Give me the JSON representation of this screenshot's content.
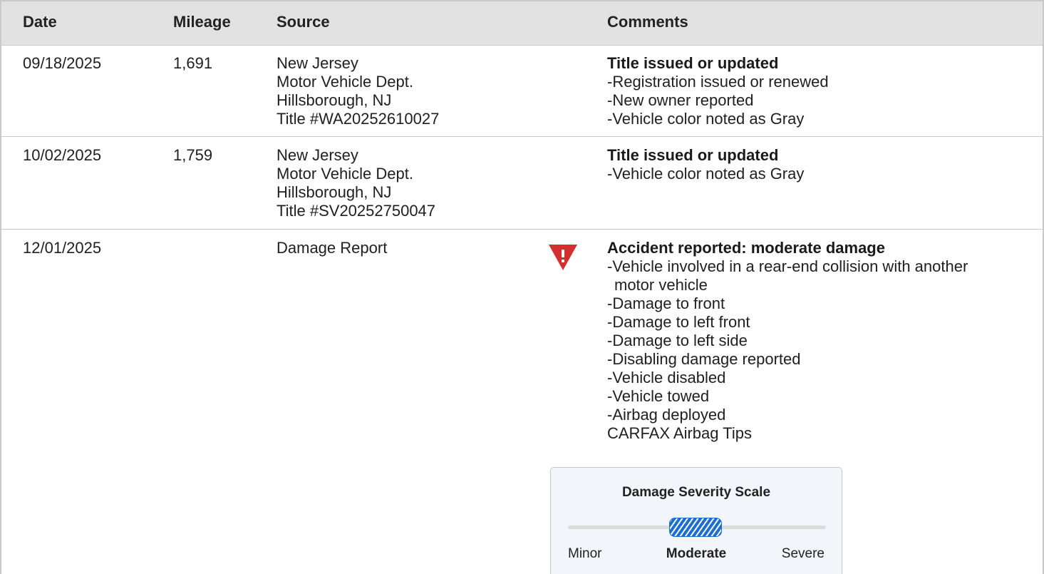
{
  "table": {
    "headers": {
      "date": "Date",
      "mileage": "Mileage",
      "source": "Source",
      "comments": "Comments"
    },
    "rows": [
      {
        "date": "09/18/2025",
        "mileage": "1,691",
        "source": [
          "New Jersey",
          "Motor Vehicle Dept.",
          "Hillsborough, NJ",
          "Title #WA20252610027"
        ],
        "event_title": "Title issued or updated",
        "details": [
          "Registration issued or renewed",
          "New owner reported",
          "Vehicle color noted as Gray"
        ]
      },
      {
        "date": "10/02/2025",
        "mileage": "1,759",
        "source": [
          "New Jersey",
          "Motor Vehicle Dept.",
          "Hillsborough, NJ",
          "Title #SV20252750047"
        ],
        "event_title": "Title issued or updated",
        "details": [
          "Vehicle color noted as Gray"
        ]
      },
      {
        "date": "12/01/2025",
        "mileage": "",
        "source": [
          "Damage Report"
        ],
        "icon": "warning-triangle-icon",
        "event_title": "Accident reported: moderate damage",
        "details": [
          "Vehicle involved in a rear-end collision with another motor vehicle",
          "Damage to front",
          "Damage to left front",
          "Damage to left side",
          "Disabling damage reported",
          "Vehicle disabled",
          "Vehicle towed",
          "Airbag deployed"
        ],
        "link": "CARFAX Airbag Tips"
      }
    ]
  },
  "severity_scale": {
    "title": "Damage Severity Scale",
    "labels": {
      "minor": "Minor",
      "moderate": "Moderate",
      "severe": "Severe"
    },
    "selected": "Moderate",
    "level_fraction": 0.5
  },
  "colors": {
    "header_bg": "#e2e2e2",
    "alert_red": "#d32f2f",
    "severity_blue": "#1c6fd1",
    "scale_box_bg": "#f2f6fa"
  },
  "prefix": "-"
}
